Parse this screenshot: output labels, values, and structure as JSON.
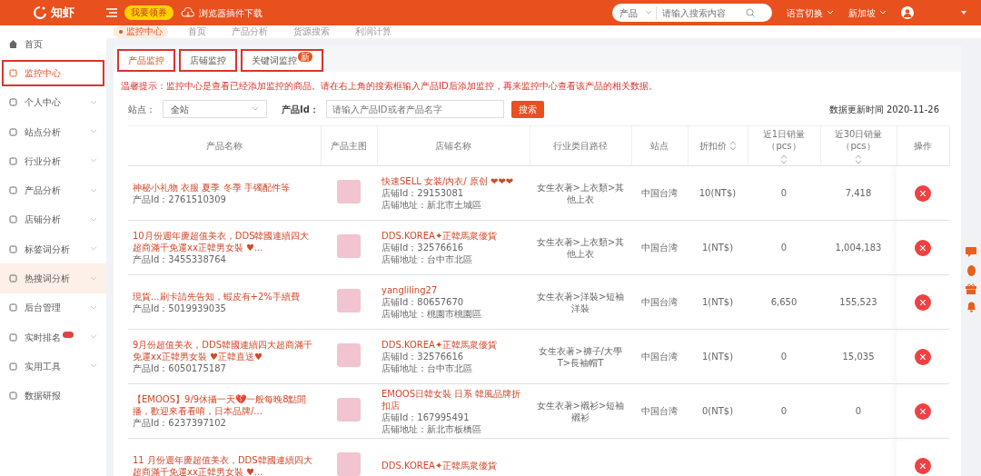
{
  "header": {
    "logo": "知虾",
    "coupon_button": "我要领券",
    "plugin_download": "浏览器插件下载",
    "search": {
      "scope": "产品",
      "placeholder": "请输入搜索内容"
    },
    "menus": [
      "语言切换",
      "新加坡"
    ]
  },
  "sidebar": {
    "items": [
      {
        "label": "首页",
        "selected": false,
        "highlighted": false,
        "expandable": false
      },
      {
        "label": "监控中心",
        "selected": true,
        "highlighted": false,
        "expandable": false
      },
      {
        "label": "个人中心",
        "selected": false,
        "highlighted": false,
        "expandable": true
      },
      {
        "label": "站点分析",
        "selected": false,
        "highlighted": false,
        "expandable": true
      },
      {
        "label": "行业分析",
        "selected": false,
        "highlighted": false,
        "expandable": true
      },
      {
        "label": "产品分析",
        "selected": false,
        "highlighted": false,
        "expandable": true
      },
      {
        "label": "店铺分析",
        "selected": false,
        "highlighted": false,
        "expandable": true
      },
      {
        "label": "标签词分析",
        "selected": false,
        "highlighted": false,
        "expandable": true
      },
      {
        "label": "热搜词分析",
        "selected": false,
        "highlighted": true,
        "expandable": true
      },
      {
        "label": "后台管理",
        "selected": false,
        "highlighted": false,
        "expandable": true
      },
      {
        "label": "实时排名",
        "selected": false,
        "highlighted": false,
        "expandable": true,
        "badge": true
      },
      {
        "label": "实用工具",
        "selected": false,
        "highlighted": false,
        "expandable": true
      },
      {
        "label": "数据研报",
        "selected": false,
        "highlighted": false,
        "expandable": false
      }
    ]
  },
  "breadcrumbs": [
    {
      "label": "监控中心",
      "selected": true
    },
    {
      "label": "首页",
      "selected": false
    },
    {
      "label": "产品分析",
      "selected": false
    },
    {
      "label": "货源搜索",
      "selected": false
    },
    {
      "label": "利润计算",
      "selected": false
    }
  ],
  "tabs": [
    {
      "label": "产品监控",
      "selected": true
    },
    {
      "label": "店铺监控",
      "selected": false
    },
    {
      "label": "关键词监控",
      "selected": false,
      "badge": "新"
    }
  ],
  "notice": "温馨提示：监控中心是查看已经添加监控的商品。请在右上角的搜索框输入产品ID后添加监控，再来监控中心查看该产品的相关数据。",
  "filters": {
    "site_label": "站点：",
    "site_value": "全站",
    "product_id_label": "产品Id：",
    "product_id_placeholder": "请输入产品ID或者产品名字",
    "search_button": "搜索",
    "updated": "数据更新时间 2020-11-26"
  },
  "table": {
    "columns": [
      {
        "label": "产品名称",
        "sortable": false
      },
      {
        "label": "产品主图",
        "sortable": false
      },
      {
        "label": "店铺名称",
        "sortable": false
      },
      {
        "label": "行业类目路径",
        "sortable": false
      },
      {
        "label": "站点",
        "sortable": false
      },
      {
        "label": "折扣价",
        "sortable": true
      },
      {
        "label": "近1日销量（pcs）",
        "sortable": true
      },
      {
        "label": "近30日销量（pcs）",
        "sortable": true
      },
      {
        "label": "操作",
        "sortable": false
      }
    ],
    "rows": [
      {
        "name": "神秘小礼物 衣服 夏季 冬季 手镯配件等",
        "product_id": "产品Id：2761510309",
        "shop": "快速SELL 女装/内衣/ 原创 ❤❤❤",
        "shop_id": "店铺Id：29153081",
        "shop_address": "店铺地址：新北市土城區",
        "category": "女生衣著>上衣類>其他上衣",
        "site": "中国台湾",
        "price": "10(NT$)",
        "sales_1d": "0",
        "sales_30d": "7,418"
      },
      {
        "name": "10月份週年慶超值美衣，DDS韓國連續四大超商滿千免運xx正韓男女裝 ♥...",
        "product_id": "产品Id：3455338764",
        "shop": "DDS.KOREA✦正韓馬衆優貨",
        "shop_id": "店铺Id：32576616",
        "shop_address": "店铺地址：台中市北區",
        "category": "女生衣著>上衣類>其他上衣",
        "site": "中国台湾",
        "price": "1(NT$)",
        "sales_1d": "0",
        "sales_30d": "1,004,183"
      },
      {
        "name": "現貨...刷卡請先告知，蝦皮有+2%手續費",
        "product_id": "产品Id：5019939035",
        "shop": "yangliling27",
        "shop_id": "店铺Id：80657670",
        "shop_address": "店铺地址：桃園市桃園區",
        "category": "女生衣著>洋裝>短袖洋裝",
        "site": "中国台湾",
        "price": "1(NT$)",
        "sales_1d": "6,650",
        "sales_30d": "155,523"
      },
      {
        "name": "9月份超值美衣，DDS韓國連續四大超商滿千免運xx正韓男女裝 ♥正韓直送♥",
        "product_id": "产品Id：6050175187",
        "shop": "DDS.KOREA✦正韓馬衆優貨",
        "shop_id": "店铺Id：32576616",
        "shop_address": "店铺地址：台中市北區",
        "category": "女生衣著>褲子/大學T>長袖帽T",
        "site": "中国台湾",
        "price": "1(NT$)",
        "sales_1d": "0",
        "sales_30d": "15,035"
      },
      {
        "name": "【EMOOS】9/9休攝一天💔一般每晚8點開播，歡迎來看看唷，日本品牌/...",
        "product_id": "产品Id：6237397102",
        "shop": "EMOOS日韓女裝 日系 韓風品牌折扣店",
        "shop_id": "店铺Id：167995491",
        "shop_address": "店铺地址：新北市板橋區",
        "category": "女生衣著>襯衫>短袖襯衫",
        "site": "中国台湾",
        "price": "0(NT$)",
        "sales_1d": "0",
        "sales_30d": "0"
      },
      {
        "name": "11 月份週年慶超值美衣，DDS韓國連續四大超商滿千免運xx正韓男女裝 ♥...",
        "shop": "DDS.KOREA✦正韓馬衆優貨"
      }
    ]
  }
}
